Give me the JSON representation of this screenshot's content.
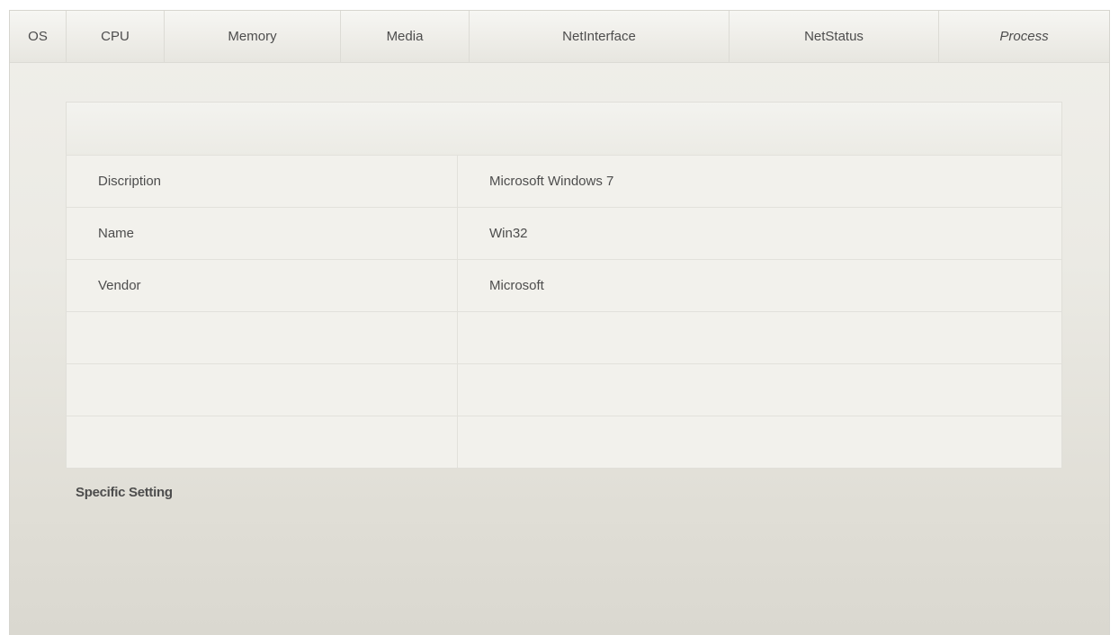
{
  "tabs": [
    {
      "label": "OS"
    },
    {
      "label": "CPU"
    },
    {
      "label": "Memory"
    },
    {
      "label": "Media"
    },
    {
      "label": "NetInterface"
    },
    {
      "label": "NetStatus"
    },
    {
      "label": "Process"
    }
  ],
  "table": {
    "header": "",
    "rows": [
      {
        "key": "Discription",
        "value": "Microsoft Windows 7"
      },
      {
        "key": "Name",
        "value": "Win32"
      },
      {
        "key": "Vendor",
        "value": "Microsoft"
      },
      {
        "key": "",
        "value": ""
      },
      {
        "key": "",
        "value": ""
      },
      {
        "key": "",
        "value": ""
      }
    ]
  },
  "footer": {
    "label": "Specific Setting"
  },
  "colors": {
    "text": "#4d4d4d",
    "border": "#dcdbd5",
    "background": "#ebeae4"
  }
}
